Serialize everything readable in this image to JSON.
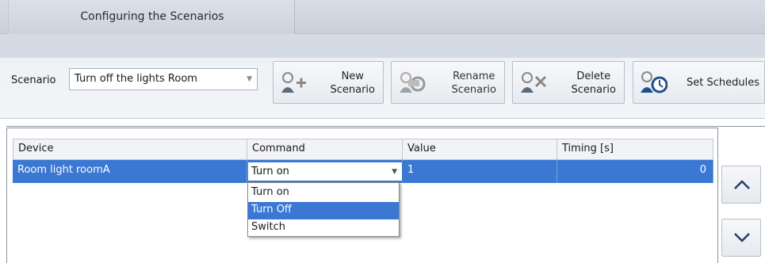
{
  "window": {
    "title": "Configuring the Scenarios"
  },
  "toolbar": {
    "scenario_label": "Scenario",
    "scenario_value": "Turn off the lights Room",
    "new_line1": "New",
    "new_line2": "Scenario",
    "rename_line1": "Rename",
    "rename_line2": "Scenario",
    "delete_line1": "Delete",
    "delete_line2": "Scenario",
    "schedules_label": "Set Schedules"
  },
  "grid": {
    "columns": [
      "Device",
      "Command",
      "Value",
      "Timing [s]"
    ],
    "rows": [
      {
        "device": "Room light roomA",
        "command": "Turn on",
        "value": "1",
        "timing": "0"
      }
    ]
  },
  "dropdown": {
    "options": [
      "Turn on",
      "Turn Off",
      "Switch"
    ],
    "selected_index": 1
  },
  "icons": {
    "new": "user-plus-icon",
    "rename": "user-rename-icon",
    "delete": "user-delete-icon",
    "schedules": "user-clock-icon",
    "up": "chevron-up-icon",
    "down": "chevron-down-icon"
  },
  "colors": {
    "selection": "#3a78d3",
    "accent": "#1f4f8f"
  }
}
